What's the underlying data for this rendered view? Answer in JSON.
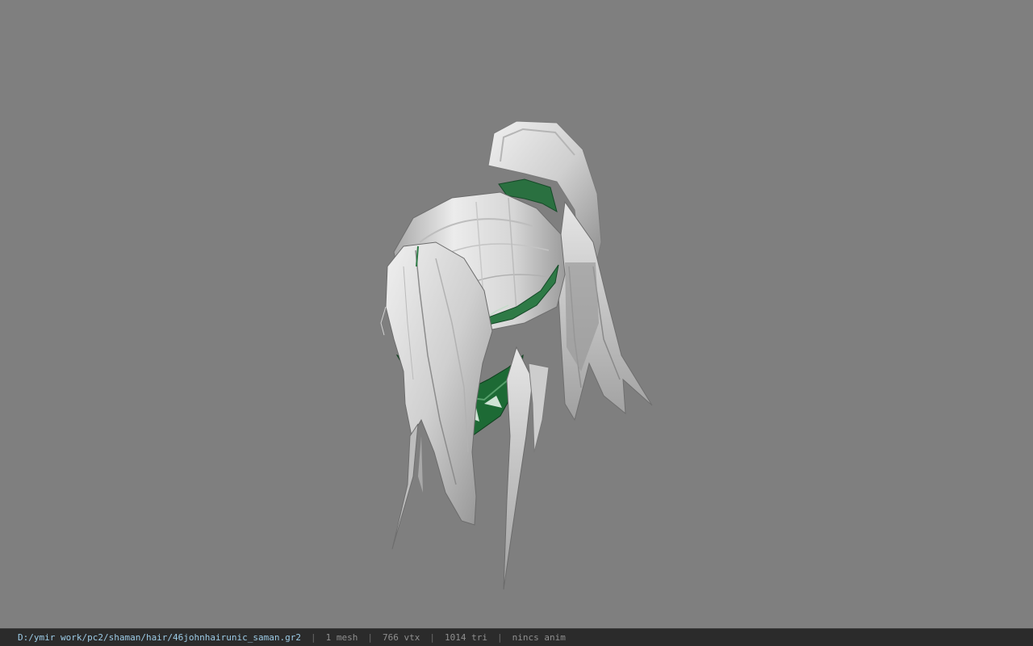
{
  "viewport": {
    "background_color": "#7f7f7f",
    "model_name": "hair-model"
  },
  "status": {
    "file_path": "D:/ymir work/pc2/shaman/hair/46johnhairunic_saman.gr2",
    "separator": "|",
    "mesh": "1 mesh",
    "vertices": "766 vtx",
    "triangles": "1014 tri",
    "anim": "nincs anim"
  },
  "colors": {
    "path_text": "#9ccbe6",
    "status_text": "#8f8f8f",
    "statusbar_bg": "#2b2b2b",
    "hair_light": "#e8e8e8",
    "hair_shadow": "#9a9a9a",
    "ribbon": "#1f6b38"
  }
}
